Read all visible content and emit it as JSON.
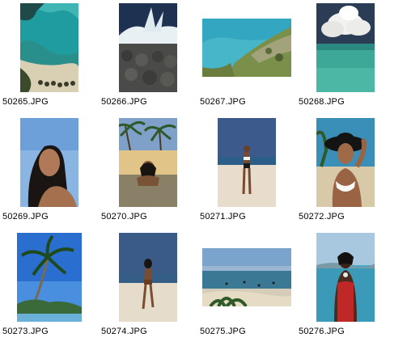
{
  "window": {
    "view": "thumbnails"
  },
  "items": [
    {
      "filename": "50265.JPG",
      "subject": "aerial-beach-cove",
      "orientation": "portrait"
    },
    {
      "filename": "50266.JPG",
      "subject": "wave-on-rocks",
      "orientation": "portrait"
    },
    {
      "filename": "50267.JPG",
      "subject": "coastline-island",
      "orientation": "landscape"
    },
    {
      "filename": "50268.JPG",
      "subject": "clouds-over-lagoon",
      "orientation": "portrait"
    },
    {
      "filename": "50269.JPG",
      "subject": "woman-portrait-sky",
      "orientation": "portrait"
    },
    {
      "filename": "50270.JPG",
      "subject": "woman-lying-in-water-palms",
      "orientation": "portrait"
    },
    {
      "filename": "50271.JPG",
      "subject": "woman-standing-on-beach",
      "orientation": "portrait"
    },
    {
      "filename": "50272.JPG",
      "subject": "woman-in-hat",
      "orientation": "portrait"
    },
    {
      "filename": "50273.JPG",
      "subject": "palm-tree-sky",
      "orientation": "portrait"
    },
    {
      "filename": "50274.JPG",
      "subject": "woman-walking-to-sea",
      "orientation": "portrait"
    },
    {
      "filename": "50275.JPG",
      "subject": "beach-panorama",
      "orientation": "landscape"
    },
    {
      "filename": "50276.JPG",
      "subject": "woman-red-swimsuit",
      "orientation": "portrait"
    }
  ],
  "colors": {
    "background": "#ffffff",
    "caption_text": "#000000"
  }
}
